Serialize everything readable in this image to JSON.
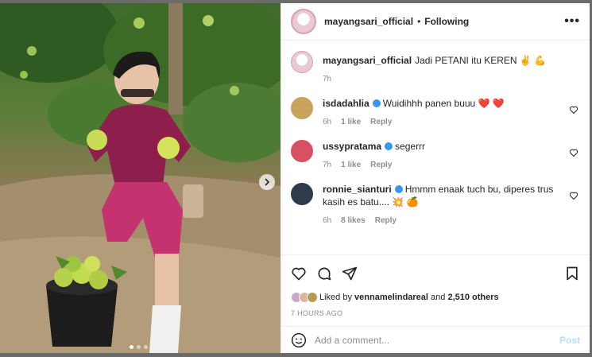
{
  "header": {
    "username": "mayangsari_official",
    "separator": "•",
    "follow_status": "Following",
    "more_label": "•••"
  },
  "caption": {
    "username": "mayangsari_official",
    "text": "Jadi PETANI itu KEREN ✌️ 💪",
    "time": "7h"
  },
  "comments": [
    {
      "username": "isdadahlia",
      "verified": true,
      "text": "Wuidihhh panen buuu ❤️ ❤️",
      "time": "6h",
      "likes": "1 like",
      "reply": "Reply"
    },
    {
      "username": "ussypratama",
      "verified": true,
      "text": "segerrr",
      "time": "7h",
      "likes": "1 like",
      "reply": "Reply"
    },
    {
      "username": "ronnie_sianturi",
      "verified": true,
      "text": "Hmmm enaak tuch bu, diperes trus kasih es batu.... 💥 🍊",
      "time": "6h",
      "likes": "8 likes",
      "reply": "Reply"
    }
  ],
  "likes": {
    "prefix": "Liked by",
    "user": "vennamelindareal",
    "mid": "and",
    "others": "2,510 others"
  },
  "posted_ago": "7 HOURS AGO",
  "add_comment": {
    "placeholder": "Add a comment...",
    "post_label": "Post"
  },
  "colors": {
    "verified": "#3897f0",
    "heart": "#ed4956",
    "post_disabled": "#b2dffc",
    "muted": "#8e8e8e"
  }
}
